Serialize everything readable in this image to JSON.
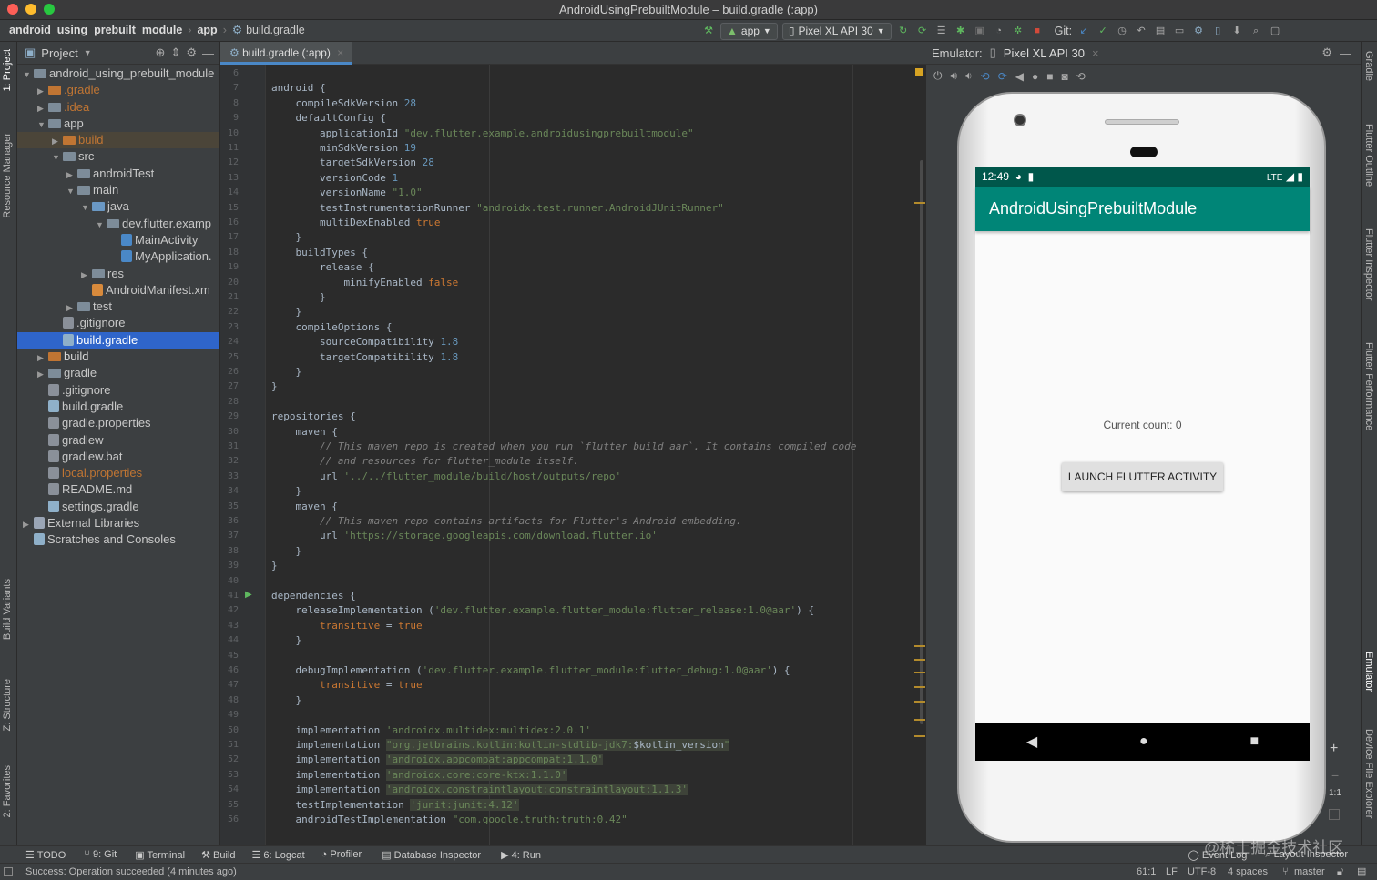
{
  "window": {
    "title": "AndroidUsingPrebuiltModule – build.gradle (:app)"
  },
  "breadcrumb": [
    "android_using_prebuilt_module",
    "app",
    "build.gradle"
  ],
  "toolbar": {
    "run_config": "app",
    "device": "Pixel XL API 30",
    "git_label": "Git:"
  },
  "left_tabs": [
    "1: Project",
    "Resource Manager",
    "Build Variants",
    "Z: Structure",
    "2: Favorites"
  ],
  "right_tabs": [
    "Gradle",
    "Flutter Outline",
    "Flutter Inspector",
    "Flutter Performance",
    "Emulator",
    "Device File Explorer"
  ],
  "project": {
    "header": "Project",
    "items": [
      {
        "label": "android_using_prebuilt_module",
        "depth": 0,
        "arrow": "▼",
        "icon": "folder"
      },
      {
        "label": ".gradle",
        "depth": 1,
        "arrow": "▶",
        "icon": "folder-orange",
        "dim": true
      },
      {
        "label": ".idea",
        "depth": 1,
        "arrow": "▶",
        "icon": "folder",
        "dim": true
      },
      {
        "label": "app",
        "depth": 1,
        "arrow": "▼",
        "icon": "folder"
      },
      {
        "label": "build",
        "depth": 2,
        "arrow": "▶",
        "icon": "folder-orange",
        "dim": true
      },
      {
        "label": "src",
        "depth": 2,
        "arrow": "▼",
        "icon": "folder"
      },
      {
        "label": "androidTest",
        "depth": 3,
        "arrow": "▶",
        "icon": "folder"
      },
      {
        "label": "main",
        "depth": 3,
        "arrow": "▼",
        "icon": "folder"
      },
      {
        "label": "java",
        "depth": 4,
        "arrow": "▼",
        "icon": "folder-blue"
      },
      {
        "label": "dev.flutter.examp",
        "depth": 5,
        "arrow": "▼",
        "icon": "folder"
      },
      {
        "label": "MainActivity",
        "depth": 6,
        "arrow": "",
        "icon": "class"
      },
      {
        "label": "MyApplication.",
        "depth": 6,
        "arrow": "",
        "icon": "class"
      },
      {
        "label": "res",
        "depth": 4,
        "arrow": "▶",
        "icon": "folder"
      },
      {
        "label": "AndroidManifest.xm",
        "depth": 4,
        "arrow": "",
        "icon": "xml"
      },
      {
        "label": "test",
        "depth": 3,
        "arrow": "▶",
        "icon": "folder"
      },
      {
        "label": ".gitignore",
        "depth": 2,
        "arrow": "",
        "icon": "file"
      },
      {
        "label": "build.gradle",
        "depth": 2,
        "arrow": "",
        "icon": "gradle",
        "selected": true
      },
      {
        "label": "build",
        "depth": 1,
        "arrow": "▶",
        "icon": "folder-orange"
      },
      {
        "label": "gradle",
        "depth": 1,
        "arrow": "▶",
        "icon": "folder"
      },
      {
        "label": ".gitignore",
        "depth": 1,
        "arrow": "",
        "icon": "file"
      },
      {
        "label": "build.gradle",
        "depth": 1,
        "arrow": "",
        "icon": "gradle"
      },
      {
        "label": "gradle.properties",
        "depth": 1,
        "arrow": "",
        "icon": "file"
      },
      {
        "label": "gradlew",
        "depth": 1,
        "arrow": "",
        "icon": "file"
      },
      {
        "label": "gradlew.bat",
        "depth": 1,
        "arrow": "",
        "icon": "file"
      },
      {
        "label": "local.properties",
        "depth": 1,
        "arrow": "",
        "icon": "file",
        "dim": true
      },
      {
        "label": "README.md",
        "depth": 1,
        "arrow": "",
        "icon": "file"
      },
      {
        "label": "settings.gradle",
        "depth": 1,
        "arrow": "",
        "icon": "gradle"
      },
      {
        "label": "External Libraries",
        "depth": 0,
        "arrow": "▶",
        "icon": "lib"
      },
      {
        "label": "Scratches and Consoles",
        "depth": 0,
        "arrow": "",
        "icon": "scratch"
      }
    ]
  },
  "editor": {
    "tab": "build.gradle (:app)",
    "first_line": 6,
    "lines": [
      [],
      [
        [
          "k",
          ""
        ],
        [
          "t",
          "android {"
        ]
      ],
      [
        [
          "t",
          "    compileSdkVersion "
        ],
        [
          "n",
          "28"
        ]
      ],
      [
        [
          "t",
          "    defaultConfig {"
        ]
      ],
      [
        [
          "t",
          "        applicationId "
        ],
        [
          "s",
          "\"dev.flutter.example.androidusingprebuiltmodule\""
        ]
      ],
      [
        [
          "t",
          "        minSdkVersion "
        ],
        [
          "n",
          "19"
        ]
      ],
      [
        [
          "t",
          "        targetSdkVersion "
        ],
        [
          "n",
          "28"
        ]
      ],
      [
        [
          "t",
          "        versionCode "
        ],
        [
          "n",
          "1"
        ]
      ],
      [
        [
          "t",
          "        versionName "
        ],
        [
          "s",
          "\"1.0\""
        ]
      ],
      [
        [
          "t",
          "        testInstrumentationRunner "
        ],
        [
          "s",
          "\"androidx.test.runner.AndroidJUnitRunner\""
        ]
      ],
      [
        [
          "t",
          "        multiDexEnabled "
        ],
        [
          "k",
          "true"
        ]
      ],
      [
        [
          "t",
          "    }"
        ]
      ],
      [
        [
          "t",
          "    buildTypes {"
        ]
      ],
      [
        [
          "t",
          "        release {"
        ]
      ],
      [
        [
          "t",
          "            minifyEnabled "
        ],
        [
          "k",
          "false"
        ]
      ],
      [
        [
          "t",
          "        }"
        ]
      ],
      [
        [
          "t",
          "    }"
        ]
      ],
      [
        [
          "t",
          "    compileOptions {"
        ]
      ],
      [
        [
          "t",
          "        sourceCompatibility "
        ],
        [
          "n",
          "1.8"
        ]
      ],
      [
        [
          "t",
          "        targetCompatibility "
        ],
        [
          "n",
          "1.8"
        ]
      ],
      [
        [
          "t",
          "    }"
        ]
      ],
      [
        [
          "t",
          "}"
        ]
      ],
      [],
      [
        [
          "t",
          "repositories {"
        ]
      ],
      [
        [
          "t",
          "    maven {"
        ]
      ],
      [
        [
          "c",
          "        // This maven repo is created when you run `flutter build aar`. It contains compiled code"
        ]
      ],
      [
        [
          "c",
          "        // and resources for flutter_module itself."
        ]
      ],
      [
        [
          "t",
          "        url "
        ],
        [
          "s",
          "'../../flutter_module/build/host/outputs/repo'"
        ]
      ],
      [
        [
          "t",
          "    }"
        ]
      ],
      [
        [
          "t",
          "    maven {"
        ]
      ],
      [
        [
          "c",
          "        // This maven repo contains artifacts for Flutter's Android embedding."
        ]
      ],
      [
        [
          "t",
          "        url "
        ],
        [
          "s",
          "'https://storage.googleapis.com/download.flutter.io'"
        ]
      ],
      [
        [
          "t",
          "    }"
        ]
      ],
      [
        [
          "t",
          "}"
        ]
      ],
      [],
      [
        [
          "t",
          "dependencies {"
        ]
      ],
      [
        [
          "t",
          "    releaseImplementation ("
        ],
        [
          "s",
          "'dev.flutter.example.flutter_module:flutter_release:1.0@aar'"
        ],
        [
          "t",
          ") {"
        ]
      ],
      [
        [
          "t",
          "        "
        ],
        [
          "k",
          "transitive"
        ],
        [
          "t",
          " = "
        ],
        [
          "k",
          "true"
        ]
      ],
      [
        [
          "t",
          "    }"
        ]
      ],
      [],
      [
        [
          "t",
          "    debugImplementation ("
        ],
        [
          "s",
          "'dev.flutter.example.flutter_module:flutter_debug:1.0@aar'"
        ],
        [
          "t",
          ") {"
        ]
      ],
      [
        [
          "t",
          "        "
        ],
        [
          "k",
          "transitive"
        ],
        [
          "t",
          " = "
        ],
        [
          "k",
          "true"
        ]
      ],
      [
        [
          "t",
          "    }"
        ]
      ],
      [],
      [
        [
          "t",
          "    implementation "
        ],
        [
          "s",
          "'androidx.multidex:multidex:2.0.1'"
        ]
      ],
      [
        [
          "t",
          "    implementation "
        ],
        [
          "sb",
          "\"org.jetbrains.kotlin:kotlin-stdlib-jdk7:"
        ],
        [
          "tb",
          "$kotlin_version"
        ],
        [
          "sb",
          "\""
        ]
      ],
      [
        [
          "t",
          "    implementation "
        ],
        [
          "sb",
          "'androidx.appcompat:appcompat:1.1.0'"
        ]
      ],
      [
        [
          "t",
          "    implementation "
        ],
        [
          "sb",
          "'androidx.core:core-ktx:1.1.0'"
        ]
      ],
      [
        [
          "t",
          "    implementation "
        ],
        [
          "sb",
          "'androidx.constraintlayout:constraintlayout:1.1.3'"
        ]
      ],
      [
        [
          "t",
          "    testImplementation "
        ],
        [
          "sb",
          "'junit:junit:4.12'"
        ]
      ],
      [
        [
          "t",
          "    androidTestImplementation "
        ],
        [
          "s",
          "\"com.google.truth:truth:0.42\""
        ]
      ]
    ]
  },
  "emulator": {
    "label": "Emulator:",
    "device_tab": "Pixel XL API 30",
    "time": "12:49",
    "network": "LTE",
    "app_title": "AndroidUsingPrebuiltModule",
    "counter_text": "Current count: 0",
    "launch_button": "LAUNCH FLUTTER ACTIVITY",
    "zoom": "1:1"
  },
  "bottom_tabs": [
    "TODO",
    "9: Git",
    "Terminal",
    "Build",
    "6: Logcat",
    "Profiler",
    "Database Inspector",
    "4: Run"
  ],
  "bottom_right": [
    "Event Log",
    "Layout Inspector"
  ],
  "status": {
    "message": "Success: Operation succeeded (4 minutes ago)",
    "position": "61:1",
    "line_sep": "LF",
    "encoding": "UTF-8",
    "indent": "4 spaces",
    "branch": "master"
  },
  "watermark": "@稀土掘金技术社区",
  "colors": {
    "accent": "#2f65ca",
    "app_bar": "#008577",
    "status_bar": "#00574b"
  }
}
